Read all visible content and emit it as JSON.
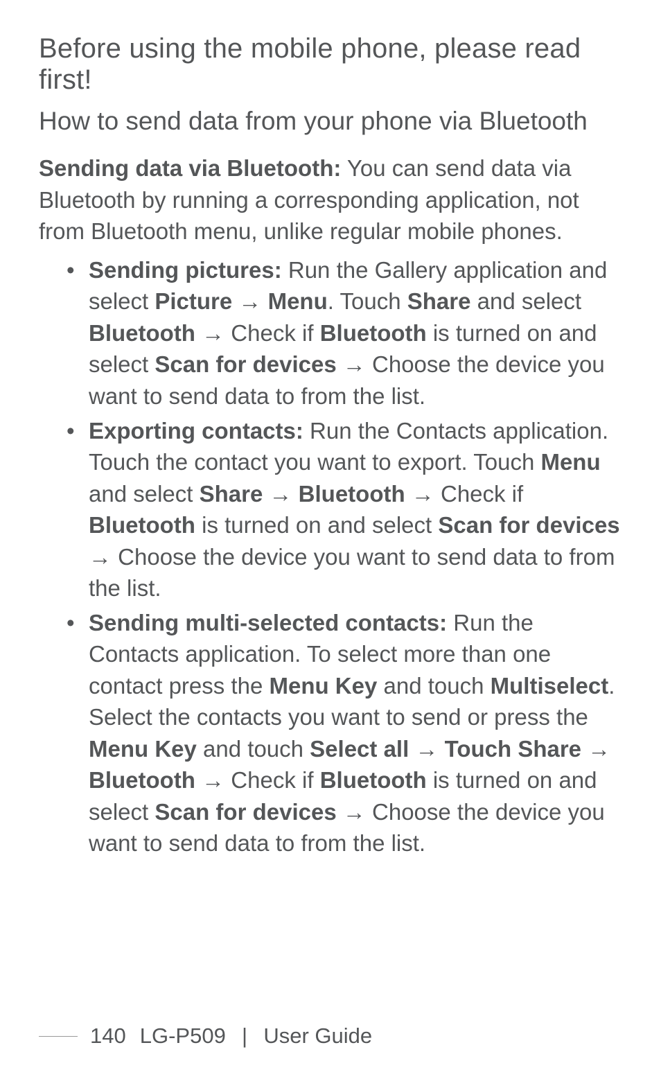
{
  "chapter_title": "Before using the mobile phone, please read first!",
  "section_title": "How to send data from your phone via Bluetooth",
  "intro": {
    "lead_bold": "Sending data via Bluetooth:",
    "lead_rest": " You can send data via Bluetooth by running a corresponding application, not from Bluetooth menu, unlike regular mobile phones."
  },
  "arrow": "→",
  "bullets": [
    {
      "lead_bold": "Sending pictures:",
      "t1": " Run the Gallery application and select ",
      "b1": "Picture",
      "t2": " ",
      "b2": "Menu",
      "t3": ". Touch ",
      "b3": "Share",
      "t4": " and select ",
      "b4": "Bluetooth",
      "t5": " ",
      "t6": " Check if ",
      "b5": "Bluetooth",
      "t7": " is turned on and select ",
      "b6": "Scan for devices",
      "t8": " ",
      "t9": " Choose the device you want to send data to from the list."
    },
    {
      "lead_bold": "Exporting contacts:",
      "t1": " Run the Contacts application. Touch the contact you want to export. Touch ",
      "b1": "Menu",
      "t2": " and select ",
      "b2": "Share",
      "t3": " ",
      "b3": "Bluetooth",
      "t4": " ",
      "t5": " Check if ",
      "b4": "Bluetooth",
      "t6": " is turned on and select ",
      "b5": "Scan for devices",
      "t7": " ",
      "t8": " Choose the device you want to send data to from the list."
    },
    {
      "lead_bold": "Sending multi-selected contacts:",
      "t1": " Run the Contacts application. To select more than one contact press the ",
      "b1": "Menu Key",
      "t2": " and touch ",
      "b2": "Multiselect",
      "t3": ". Select the contacts you want to send or press the ",
      "b3": "Menu Key",
      "t4": " and touch ",
      "b4": "Select all",
      "t5": " ",
      "b5": "Touch Share",
      "t6": " ",
      "b6": "Bluetooth",
      "t7": " ",
      "t8": " Check if ",
      "b7": "Bluetooth",
      "t9": " is turned on and select ",
      "b8": "Scan for devices",
      "t10": " ",
      "t11": " Choose the device you want to send data to from the list."
    }
  ],
  "footer": {
    "page_number": "140",
    "model": "LG-P509",
    "separator": "|",
    "guide": "User Guide"
  }
}
